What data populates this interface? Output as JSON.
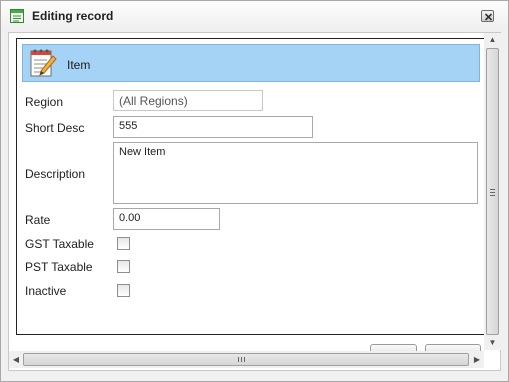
{
  "window": {
    "title": "Editing record",
    "close_icon": "close-icon",
    "title_icon": "form-icon"
  },
  "header": {
    "title": "Item",
    "icon": "notepad-pencil-icon",
    "background": "#a4d3f5"
  },
  "form": {
    "region": {
      "label": "Region",
      "value": "(All Regions)"
    },
    "short_desc": {
      "label": "Short Desc",
      "value": "555"
    },
    "description": {
      "label": "Description",
      "value": "New Item"
    },
    "rate": {
      "label": "Rate",
      "value": "0.00"
    },
    "gst_taxable": {
      "label": "GST Taxable",
      "checked": false
    },
    "pst_taxable": {
      "label": "PST Taxable",
      "checked": false
    },
    "inactive": {
      "label": "Inactive",
      "checked": false
    }
  }
}
